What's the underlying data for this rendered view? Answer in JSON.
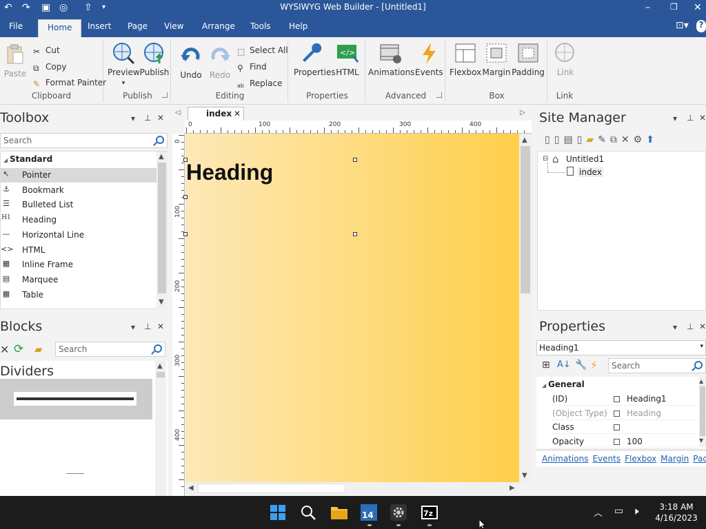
{
  "window": {
    "title": "WYSIWYG Web Builder - [Untitled1]"
  },
  "menu": [
    "File",
    "Home",
    "Insert",
    "Page",
    "View",
    "Arrange",
    "Tools",
    "Help"
  ],
  "ribbon": {
    "clipboard": {
      "paste": "Paste",
      "cut": "Cut",
      "copy": "Copy",
      "format_painter": "Format Painter",
      "label": "Clipboard"
    },
    "publish": {
      "preview": "Preview",
      "publish": "Publish",
      "label": "Publish"
    },
    "editing": {
      "undo": "Undo",
      "redo": "Redo",
      "select_all": "Select All",
      "find": "Find",
      "replace": "Replace",
      "label": "Editing"
    },
    "properties": {
      "properties": "Properties",
      "html": "HTML",
      "label": "Properties"
    },
    "advanced": {
      "animations": "Animations",
      "events": "Events",
      "label": "Advanced"
    },
    "box": {
      "flexbox": "Flexbox",
      "margin": "Margin",
      "padding": "Padding",
      "label": "Box"
    },
    "link": {
      "link": "Link",
      "label": "Link"
    }
  },
  "toolbox": {
    "title": "Toolbox",
    "search_placeholder": "Search",
    "section": "Standard",
    "items": [
      "Pointer",
      "Bookmark",
      "Bulleted List",
      "Heading",
      "Horizontal Line",
      "HTML",
      "Inline Frame",
      "Marquee",
      "Table"
    ],
    "icons": [
      "pointer-icon",
      "anchor-icon",
      "bulleted-list-icon",
      "heading-icon",
      "horizontal-line-icon",
      "html-tag-icon",
      "inline-frame-icon",
      "marquee-icon",
      "table-icon"
    ]
  },
  "blocks": {
    "title": "Blocks",
    "search_placeholder": "Search",
    "category": "Dividers"
  },
  "editor": {
    "tab": "index",
    "ruler_h": [
      "0",
      "100",
      "200",
      "300",
      "400"
    ],
    "ruler_v": [
      "0",
      "100",
      "200",
      "300",
      "400"
    ],
    "heading_text": "Heading"
  },
  "site_manager": {
    "title": "Site Manager",
    "root": "Untitled1",
    "page": "index"
  },
  "properties": {
    "title": "Properties",
    "selected": "Heading1",
    "search_placeholder": "Search",
    "section": "General",
    "rows": [
      {
        "key": "(ID)",
        "value": "Heading1"
      },
      {
        "key": "(Object Type)",
        "value": "Heading"
      },
      {
        "key": "Class",
        "value": ""
      },
      {
        "key": "Opacity",
        "value": "100"
      }
    ],
    "links": [
      "Animations",
      "Events",
      "Flexbox",
      "Margin",
      "Padding"
    ]
  },
  "taskbar": {
    "time": "3:18 AM",
    "date": "4/16/2023"
  },
  "colors": {
    "accent": "#2b579a",
    "canvas_start": "#fde9b8",
    "canvas_end": "#ffcf4a"
  }
}
